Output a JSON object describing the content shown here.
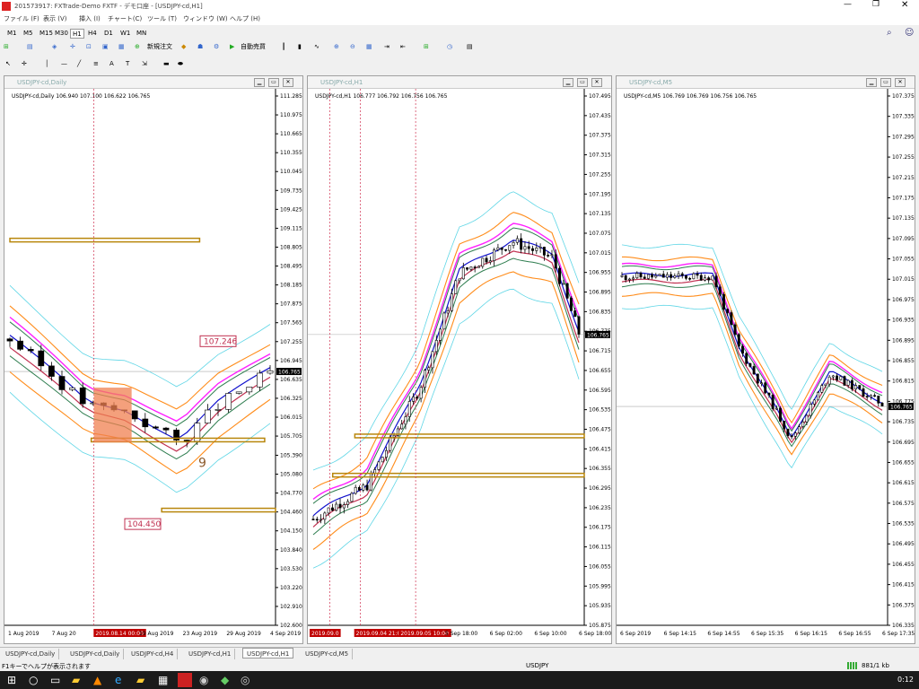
{
  "app_title": "201573917: FXTrade-Demo FXTF - デモ口座 - [USDJPY-cd,H1]",
  "menu": [
    "ファイル (F)",
    "表示 (V)",
    "挿入 (I)",
    "チャート(C)",
    "ツール (T)",
    "ウィンドウ (W)",
    "ヘルプ (H)"
  ],
  "timeframes": [
    "M1",
    "M5",
    "M15",
    "M30",
    "H1",
    "H4",
    "D1",
    "W1",
    "MN"
  ],
  "active_timeframe": "H1",
  "toolbar": {
    "new_order": "新規注文",
    "auto_trade": "自動売買"
  },
  "windows": [
    {
      "title": "USDJPY-cd,Daily",
      "info": "USDJPY-cd,Daily  106.940 107.100 106.622 106.765",
      "price_ticks": [
        "111.285",
        "110.975",
        "110.665",
        "110.355",
        "110.045",
        "109.735",
        "109.425",
        "109.115",
        "108.805",
        "108.495",
        "108.185",
        "107.875",
        "107.565",
        "107.255",
        "106.945",
        "106.635",
        "106.325",
        "106.015",
        "105.705",
        "105.390",
        "105.080",
        "104.770",
        "104.460",
        "104.150",
        "103.840",
        "103.530",
        "103.220",
        "102.910",
        "102.600"
      ],
      "time_labels": [
        "1 Aug 2019",
        "7 Aug 20",
        "2019.08.14 00:00",
        "19 Aug 2019",
        "23 Aug 2019",
        "29 Aug 2019",
        "4 Sep 2019"
      ],
      "current_price": "106.765",
      "annotations": [
        "107.246",
        "104.450",
        "9"
      ]
    },
    {
      "title": "USDJPY-cd,H1",
      "info": "USDJPY-cd,H1  106.777 106.792 106.756 106.765",
      "price_ticks": [
        "107.495",
        "107.435",
        "107.375",
        "107.315",
        "107.255",
        "107.195",
        "107.135",
        "107.075",
        "107.015",
        "106.955",
        "106.895",
        "106.835",
        "106.775",
        "106.715",
        "106.655",
        "106.595",
        "106.535",
        "106.475",
        "106.415",
        "106.355",
        "106.295",
        "106.235",
        "106.175",
        "106.115",
        "106.055",
        "105.995",
        "105.935",
        "105.875"
      ],
      "time_labels": [
        "2019.09.0",
        "2019.09.04 21:00",
        "2019.09.05 10:00",
        "5 Sep 18:00",
        "6 Sep 02:00",
        "6 Sep 10:00",
        "6 Sep 18:00"
      ],
      "current_price": "106.765"
    },
    {
      "title": "USDJPY-cd,M5",
      "info": "USDJPY-cd,M5  106.769 106.769 106.756 106.765",
      "price_ticks": [
        "107.375",
        "107.335",
        "107.295",
        "107.255",
        "107.215",
        "107.175",
        "107.135",
        "107.095",
        "107.055",
        "107.015",
        "106.975",
        "106.935",
        "106.895",
        "106.855",
        "106.815",
        "106.775",
        "106.735",
        "106.695",
        "106.655",
        "106.615",
        "106.575",
        "106.535",
        "106.495",
        "106.455",
        "106.415",
        "106.375",
        "106.335"
      ],
      "time_labels": [
        "6 Sep 2019",
        "6 Sep 14:15",
        "6 Sep 14:55",
        "6 Sep 15:35",
        "6 Sep 16:15",
        "6 Sep 16:55",
        "6 Sep 17:35"
      ],
      "current_price": "106.765"
    }
  ],
  "tabs": [
    "USDJPY-cd,Daily",
    "USDJPY-cd,Daily",
    "USDJPY-cd,H4",
    "USDJPY-cd,H1",
    "USDJPY-cd,H1",
    "USDJPY-cd,M5"
  ],
  "active_tab": 4,
  "status": {
    "help": "F1キーでヘルプが表示されます",
    "symbol": "USDJPY",
    "traffic": "881/1 kb"
  },
  "clock": "0:12",
  "colors": {
    "bull": "#ffffff",
    "bear": "#000000",
    "bb_outer": "#5fd6e6",
    "bb_mid": "#ff8c1a",
    "ma_green": "#2e7d4f",
    "ma_blue": "#1111cc",
    "magenta": "#ff20ff",
    "cloud": "#c03050",
    "level": "#b8860b"
  }
}
